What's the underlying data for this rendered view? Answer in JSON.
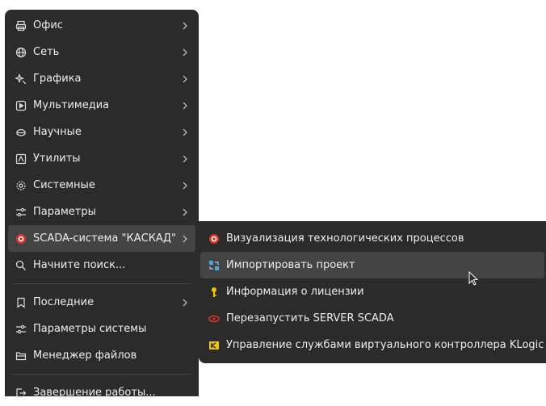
{
  "main_menu": {
    "items": [
      {
        "label": "Офис",
        "icon": "printer-icon"
      },
      {
        "label": "Сеть",
        "icon": "globe-icon"
      },
      {
        "label": "Графика",
        "icon": "sparkle-icon"
      },
      {
        "label": "Мультимедиа",
        "icon": "play-icon"
      },
      {
        "label": "Научные",
        "icon": "flask-icon"
      },
      {
        "label": "Утилиты",
        "icon": "toolbox-icon"
      },
      {
        "label": "Системные",
        "icon": "cog-icon"
      },
      {
        "label": "Параметры",
        "icon": "sliders-icon"
      },
      {
        "label": "SCADA-система \"КАСКАД\"",
        "icon": "scada-icon"
      },
      {
        "label": "Начните поиск...",
        "icon": "search-icon"
      },
      {
        "label": "Последние",
        "icon": "bookmark-icon"
      },
      {
        "label": "Параметры системы",
        "icon": "sliders-icon"
      },
      {
        "label": "Менеджер файлов",
        "icon": "folder-icon"
      },
      {
        "label": "Завершение работы...",
        "icon": "logout-icon"
      }
    ]
  },
  "submenu": {
    "items": [
      {
        "label": "Визуализация технологических процессов",
        "icon": "scada-icon"
      },
      {
        "label": "Импортировать проект",
        "icon": "import-icon"
      },
      {
        "label": "Информация о лицензии",
        "icon": "key-icon"
      },
      {
        "label": "Перезапустить SERVER SCADA",
        "icon": "restart-icon"
      },
      {
        "label": "Управление службами виртуального контроллера KLogic",
        "icon": "klogic-icon"
      }
    ]
  },
  "colors": {
    "menu_bg": "#2b2b2b",
    "hover_bg": "#444444",
    "text": "#eeeeee",
    "scada_red": "#d9342b",
    "key_yellow": "#f2c300"
  }
}
